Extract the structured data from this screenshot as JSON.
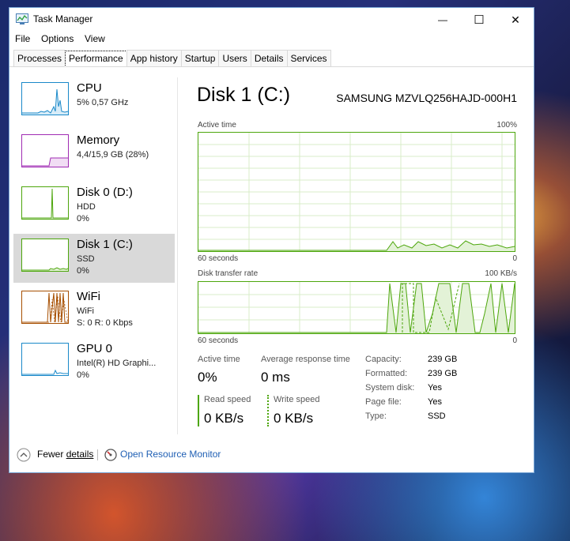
{
  "window": {
    "title": "Task Manager",
    "minimize": "—",
    "maximize": "☐",
    "close": "✕"
  },
  "menu": [
    "File",
    "Options",
    "View"
  ],
  "tabs": [
    "Processes",
    "Performance",
    "App history",
    "Startup",
    "Users",
    "Details",
    "Services"
  ],
  "sidebar": [
    {
      "name": "CPU",
      "sub": "5%  0,57 GHz",
      "sub2": "",
      "color": "#1a89c9"
    },
    {
      "name": "Memory",
      "sub": "4,4/15,9 GB (28%)",
      "sub2": "",
      "color": "#a02cb3"
    },
    {
      "name": "Disk 0 (D:)",
      "sub": "HDD",
      "sub2": "0%",
      "color": "#4da60c"
    },
    {
      "name": "Disk 1 (C:)",
      "sub": "SSD",
      "sub2": "0%",
      "color": "#4da60c"
    },
    {
      "name": "WiFi",
      "sub": "WiFi",
      "sub2": "S: 0  R: 0 Kbps",
      "color": "#a74f01"
    },
    {
      "name": "GPU 0",
      "sub": "Intel(R) HD Graphi...",
      "sub2": "0%",
      "color": "#1a89c9"
    }
  ],
  "detail": {
    "title": "Disk 1 (C:)",
    "model": "SAMSUNG MZVLQ256HAJD-000H1",
    "graph1": {
      "label": "Active time",
      "max": "100%",
      "time": "60 seconds",
      "min": "0"
    },
    "graph2": {
      "label": "Disk transfer rate",
      "max": "100 KB/s",
      "time": "60 seconds",
      "min": "0"
    },
    "stats": {
      "active_time_label": "Active time",
      "active_time": "0%",
      "avg_resp_label": "Average response time",
      "avg_resp": "0 ms",
      "read_label": "Read speed",
      "read": "0 KB/s",
      "write_label": "Write speed",
      "write": "0 KB/s"
    },
    "props": [
      {
        "k": "Capacity:",
        "v": "239 GB"
      },
      {
        "k": "Formatted:",
        "v": "239 GB"
      },
      {
        "k": "System disk:",
        "v": "Yes"
      },
      {
        "k": "Page file:",
        "v": "Yes"
      },
      {
        "k": "Type:",
        "v": "SSD"
      }
    ]
  },
  "footer": {
    "fewer_pre": "Fewer ",
    "fewer_u": "details",
    "resource_monitor": "Open Resource Monitor"
  },
  "colors": {
    "disk": "#4da60c",
    "accent_link": "#1f5fb4"
  }
}
